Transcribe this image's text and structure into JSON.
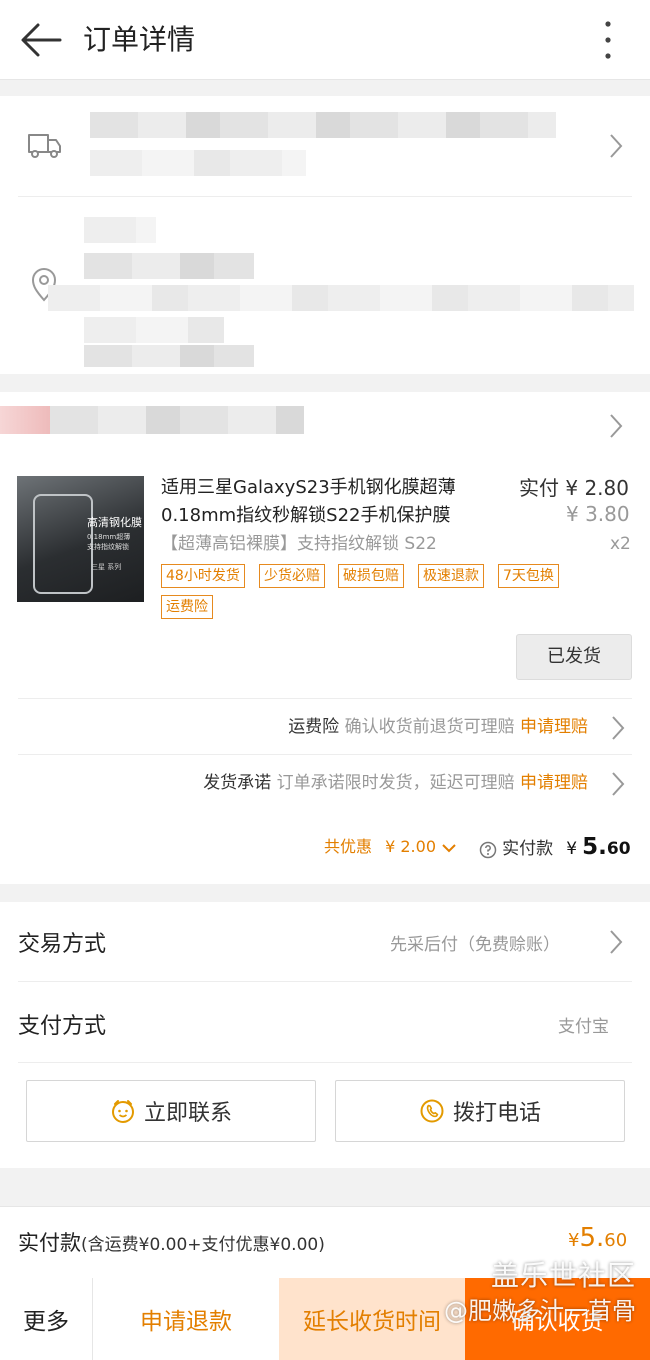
{
  "header": {
    "title": "订单详情"
  },
  "product": {
    "name": "适用三星GalaxyS23手机钢化膜超薄0.18mm指纹秒解锁S22手机保护膜",
    "paid_label": "实付 ¥ 2.80",
    "original_price": "¥ 3.80",
    "variant": "【超薄高铝裸膜】支持指纹解锁 S22",
    "quantity": "x2",
    "thumb_title": "高清钢化膜",
    "thumb_sub1": "0.18mm超薄",
    "thumb_sub2": "支持指纹解锁",
    "thumb_series": "三星 系列",
    "tags": [
      "48小时发货",
      "少货必赔",
      "破损包赔",
      "极速退款",
      "7天包换",
      "运费险"
    ],
    "status_button": "已发货"
  },
  "insurance": {
    "freight": {
      "key": "运费险",
      "desc": "确认收货前退货可理赔",
      "action": "申请理赔"
    },
    "promise": {
      "key": "发货承诺",
      "desc": "订单承诺限时发货，延迟可理赔",
      "action": "申请理赔"
    }
  },
  "summary": {
    "discount_label": "共优惠",
    "discount_value": "¥ 2.00",
    "paid_label": "实付款",
    "paid_currency": "¥",
    "paid_int": "5.",
    "paid_dec": "60"
  },
  "trade": {
    "label": "交易方式",
    "value": "先采后付（免费赊账）"
  },
  "payment": {
    "label": "支付方式",
    "value": "支付宝"
  },
  "contact": {
    "chat": "立即联系",
    "call": "拨打电话"
  },
  "total": {
    "label": "实付款",
    "detail": "(含运费¥0.00+支付优惠¥0.00)",
    "currency": "¥",
    "int": "5.",
    "dec": "60"
  },
  "bottom": {
    "more": "更多",
    "refund": "申请退款",
    "extend": "延长收货时间",
    "confirm": "确认收货"
  },
  "watermark": {
    "line1": "盖乐世社区",
    "line2": "@肥嫩多汁一苜骨"
  },
  "colors": {
    "accent": "#e37f00",
    "confirm_bg": "#ff6a00",
    "extend_bg": "#ffe3cc"
  },
  "icons": [
    "back-arrow-icon",
    "more-vertical-icon",
    "truck-icon",
    "location-pin-icon",
    "chevron-right-icon",
    "chevron-down-icon",
    "help-circle-icon",
    "chat-face-icon",
    "phone-icon"
  ]
}
